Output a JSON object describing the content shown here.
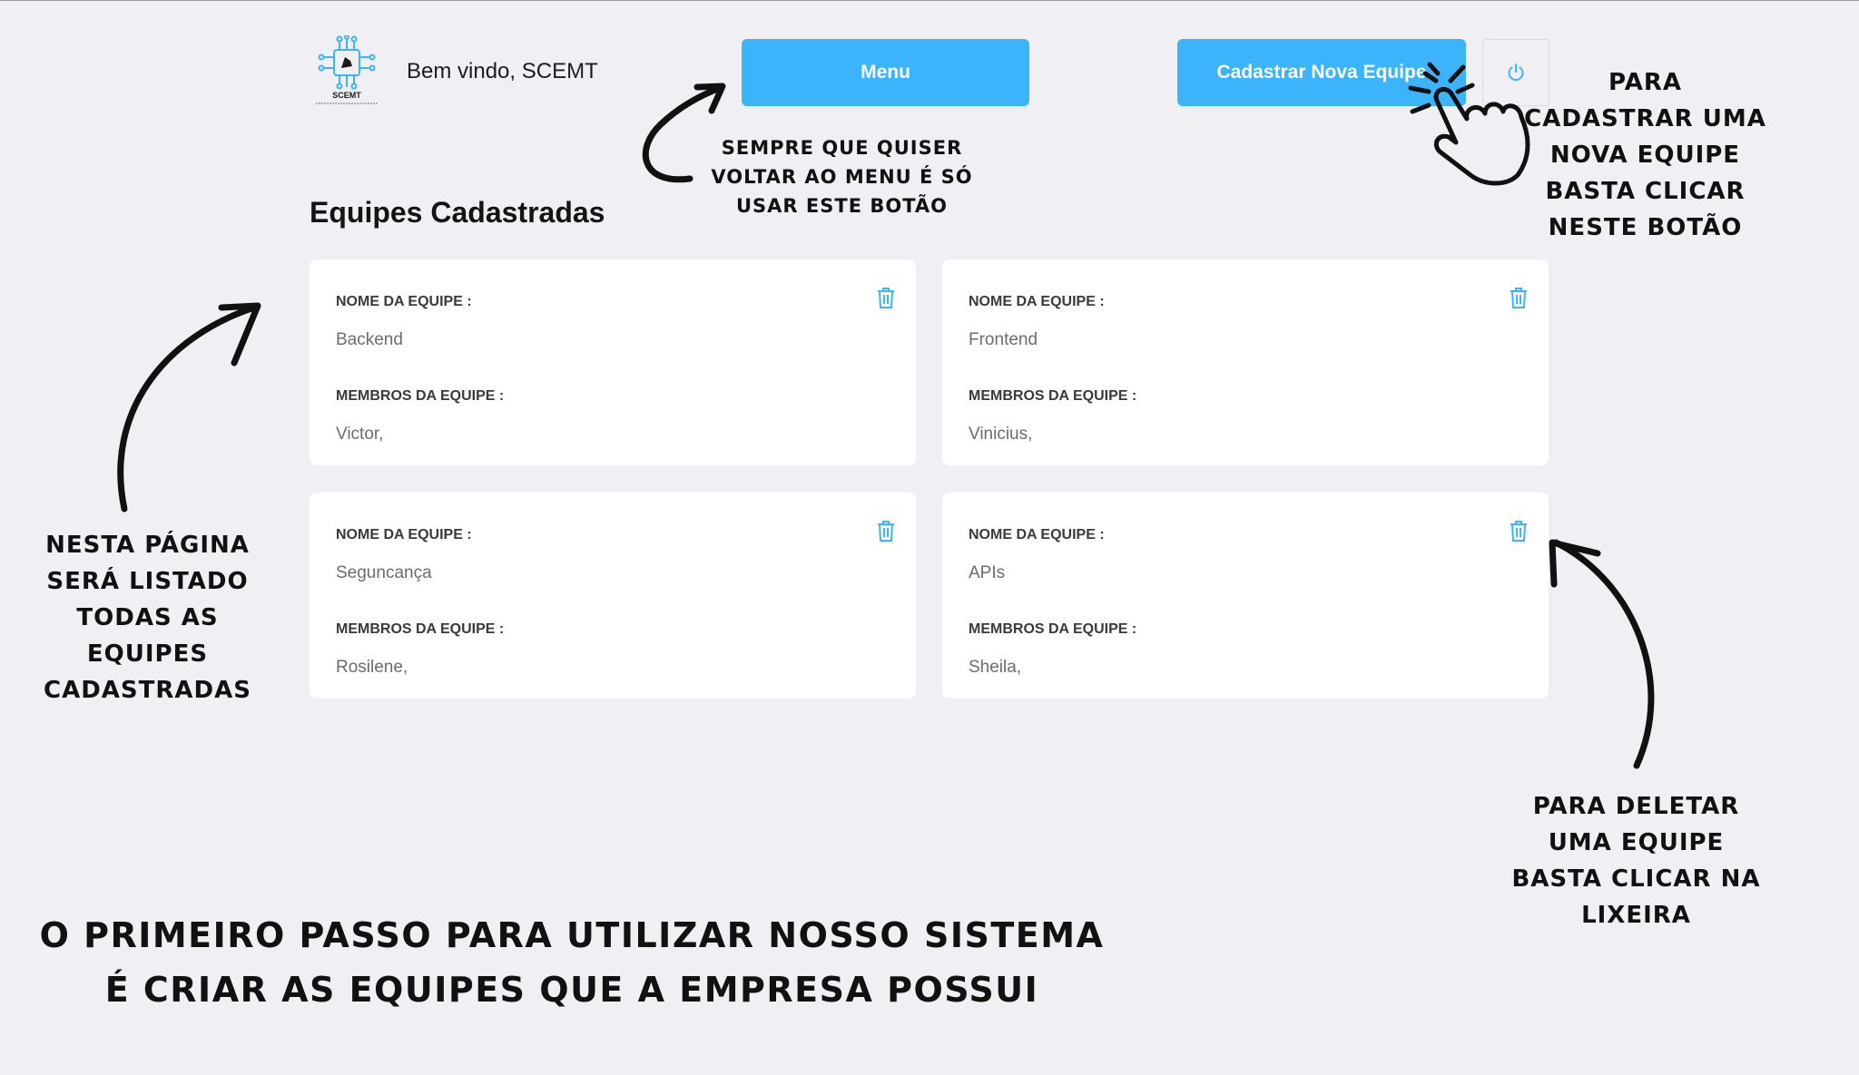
{
  "header": {
    "logo_text": "SCEMT",
    "welcome": "Bem vindo, SCEMT",
    "menu_label": "Menu",
    "new_team_label": "Cadastrar Nova Equipe",
    "power_icon": "power-icon"
  },
  "page_title": "Equipes Cadastradas",
  "teams": [
    {
      "name_label": "NOME DA EQUIPE :",
      "name": "Backend",
      "members_label": "MEMBROS DA EQUIPE :",
      "members": "Victor,"
    },
    {
      "name_label": "NOME DA EQUIPE :",
      "name": "Frontend",
      "members_label": "MEMBROS DA EQUIPE :",
      "members": "Vinicius,"
    },
    {
      "name_label": "NOME DA EQUIPE :",
      "name": "Seguncança",
      "members_label": "MEMBROS DA EQUIPE :",
      "members": "Rosilene,"
    },
    {
      "name_label": "NOME DA EQUIPE :",
      "name": "APIs",
      "members_label": "MEMBROS DA EQUIPE :",
      "members": "Sheila,"
    }
  ],
  "annotations": {
    "menu_note": "Sempre que quiser voltar ao menu é só usar este botão",
    "new_team_note": "Para cadastrar uma nova equipe basta clicar neste botão",
    "list_note": "Nesta página será listado todas as equipes cadastradas",
    "delete_note": "Para deletar uma equipe basta clicar na lixeira",
    "first_step_note_line1": "O primeiro passo para utilizar nosso sistema",
    "first_step_note_line2": "é criar as equipes que a empresa possui"
  },
  "colors": {
    "accent": "#3bb4fb",
    "background": "#f0f0f4",
    "card": "#ffffff",
    "trash_icon": "#3bb4fb"
  }
}
